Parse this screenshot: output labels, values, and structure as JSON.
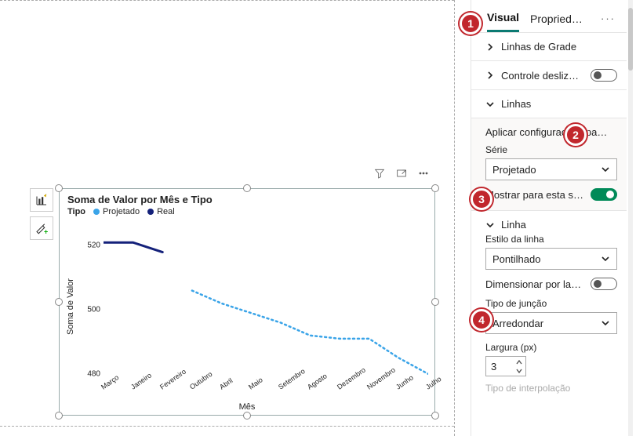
{
  "tabs": {
    "visual": "Visual",
    "properties": "Propried…",
    "more": "···"
  },
  "sections": {
    "grid_lines": "Linhas de Grade",
    "slider_control": "Controle deslizan…",
    "lines": "Linhas",
    "line_sub": "Linha"
  },
  "apply_to": {
    "title": "Aplicar configurações pa…",
    "series_label": "Série",
    "series_value": "Projetado",
    "show_for_this": "Mostrar para esta s…"
  },
  "line_style": {
    "label": "Estilo da linha",
    "value": "Pontilhado",
    "scale_label": "Dimensionar por la…",
    "join_type_label": "Tipo de junção",
    "join_type_value": "Arredondar",
    "width_label": "Largura (px)",
    "width_value": "3",
    "interpolation_label": "Tipo de interpolação"
  },
  "chart": {
    "title": "Soma de Valor por Mês e Tipo",
    "legend_prefix": "Tipo",
    "series_a": "Projetado",
    "series_b": "Real",
    "y_title": "Soma de Valor",
    "x_title": "Mês",
    "color_a": "#3aa4e8",
    "color_b": "#14217a"
  },
  "chart_data": {
    "type": "line",
    "title": "Soma de Valor por Mês e Tipo",
    "xlabel": "Mês",
    "ylabel": "Soma de Valor",
    "ylim": [
      478,
      524
    ],
    "y_ticks": [
      480,
      500,
      520
    ],
    "categories": [
      "Março",
      "Janeiro",
      "Fevereiro",
      "Outubro",
      "Abril",
      "Maio",
      "Setembro",
      "Agosto",
      "Dezembro",
      "Novembro",
      "Junho",
      "Julho"
    ],
    "series": [
      {
        "name": "Real",
        "style": "solid",
        "color": "#14217a",
        "values": [
          521,
          521,
          518,
          null,
          null,
          null,
          null,
          null,
          null,
          null,
          null,
          null
        ]
      },
      {
        "name": "Projetado",
        "style": "dotted",
        "color": "#3aa4e8",
        "values": [
          null,
          null,
          null,
          506,
          502,
          499,
          496,
          492,
          491,
          491,
          485,
          480
        ]
      }
    ]
  },
  "annotations": {
    "b1": "1",
    "b2": "2",
    "b3": "3",
    "b4": "4"
  }
}
